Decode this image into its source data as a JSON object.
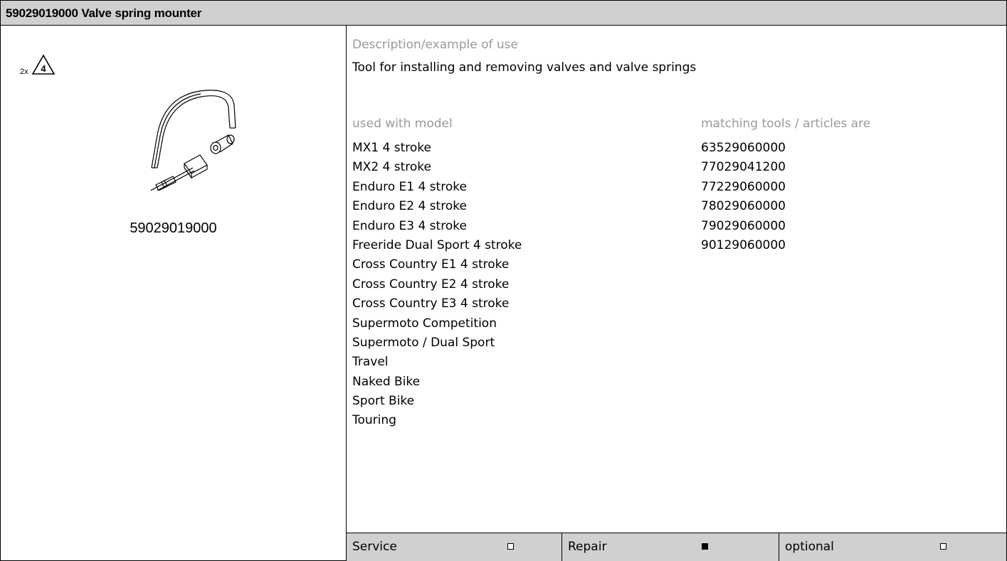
{
  "header": {
    "title": "59029019000 Valve spring mounter"
  },
  "image_panel": {
    "quantity": "2x",
    "warning_number": "4",
    "part_number": "59029019000"
  },
  "description": {
    "label": "Description/example of use",
    "text": "Tool for installing and removing valves and valve springs"
  },
  "models": {
    "label": "used with model",
    "items": [
      "MX1 4 stroke",
      "MX2 4 stroke",
      "Enduro E1 4 stroke",
      "Enduro E2 4 stroke",
      "Enduro E3 4 stroke",
      "Freeride Dual Sport 4 stroke",
      "Cross Country E1 4 stroke",
      "Cross Country E2 4 stroke",
      "Cross Country E3 4 stroke",
      "Supermoto Competition",
      "Supermoto / Dual Sport",
      "Travel",
      "Naked Bike",
      "Sport Bike",
      "Touring"
    ]
  },
  "matching_tools": {
    "label": "matching tools / articles are",
    "items": [
      "63529060000",
      "77029041200",
      "77229060000",
      "78029060000",
      "79029060000",
      "90129060000"
    ]
  },
  "footer": {
    "options": [
      {
        "label": "Service",
        "checked": false
      },
      {
        "label": "Repair",
        "checked": true
      },
      {
        "label": "optional",
        "checked": false
      }
    ]
  }
}
